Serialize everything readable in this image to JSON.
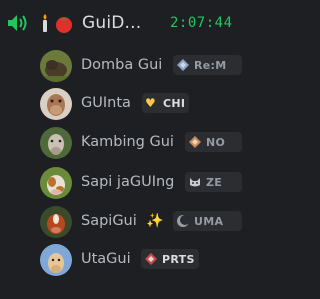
{
  "header": {
    "title": "GuiD...",
    "time": "2:07:44",
    "icons": [
      "voice-activity-icon",
      "torch-icon",
      "tomato-icon"
    ]
  },
  "members": [
    {
      "name": "Domba Gui",
      "tag": "Re:M",
      "tag_icon": "diamond-guild-icon",
      "avatar": "sheep-avatar"
    },
    {
      "name": "GUInta",
      "tag": "CHI",
      "tag_icon": "yellow-heart-icon",
      "avatar": "camel-avatar"
    },
    {
      "name": "Kambing Gui",
      "tag": "NO",
      "tag_icon": "diamond-guild-icon",
      "avatar": "goat-avatar"
    },
    {
      "name": "Sapi jaGUIng",
      "tag": "ZE",
      "tag_icon": "cat-face-icon",
      "avatar": "cow-avatar"
    },
    {
      "name": "SapiGui",
      "decoration": "✨",
      "tag": "UMA",
      "tag_icon": "moon-crescent-icon",
      "avatar": "red-cow-avatar"
    },
    {
      "name": "UtaGui",
      "tag": "PRTS",
      "tag_icon": "diamond-guild-icon",
      "avatar": "llama-avatar"
    }
  ],
  "colors": {
    "background": "#1e1f22",
    "clock": "#23c55e",
    "name": "#b5bac1",
    "tag_bg": "#2b2d31"
  }
}
